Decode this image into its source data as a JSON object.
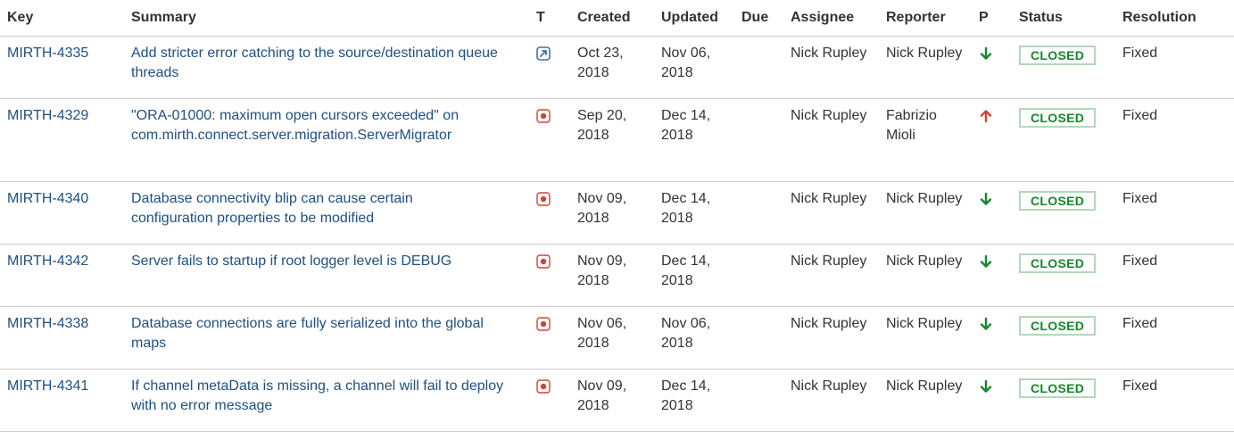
{
  "columns": {
    "key": "Key",
    "summary": "Summary",
    "type": "T",
    "created": "Created",
    "updated": "Updated",
    "due": "Due",
    "assignee": "Assignee",
    "reporter": "Reporter",
    "priority": "P",
    "status": "Status",
    "resolution": "Resolution"
  },
  "colors": {
    "link": "#205081",
    "status_closed_text": "#14892c",
    "status_closed_border": "#b2d8b9",
    "priority_low": "#14892c",
    "priority_high": "#d04437",
    "bug_icon": "#d04437",
    "improvement_icon": "#3b73af"
  },
  "issues": [
    {
      "key": "MIRTH-4335",
      "summary": "Add stricter error catching to the source/destination queue threads",
      "type_icon": "improvement-icon",
      "created": "Oct 23, 2018",
      "updated": "Nov 06, 2018",
      "due": "",
      "assignee": "Nick Rupley",
      "reporter": "Nick Rupley",
      "priority_icon": "arrow-down-icon",
      "status": "CLOSED",
      "resolution": "Fixed"
    },
    {
      "key": "MIRTH-4329",
      "summary": "\"ORA-01000: maximum open cursors exceeded\" on com.mirth.connect.server.migration.ServerMigrator",
      "type_icon": "bug-icon",
      "created": "Sep 20, 2018",
      "updated": "Dec 14, 2018",
      "due": "",
      "assignee": "Nick Rupley",
      "reporter": "Fabrizio Mioli",
      "priority_icon": "arrow-up-icon",
      "status": "CLOSED",
      "resolution": "Fixed"
    },
    {
      "key": "MIRTH-4340",
      "summary": "Database connectivity blip can cause certain configuration properties to be modified",
      "type_icon": "bug-icon",
      "created": "Nov 09, 2018",
      "updated": "Dec 14, 2018",
      "due": "",
      "assignee": "Nick Rupley",
      "reporter": "Nick Rupley",
      "priority_icon": "arrow-down-icon",
      "status": "CLOSED",
      "resolution": "Fixed"
    },
    {
      "key": "MIRTH-4342",
      "summary": "Server fails to startup if root logger level is DEBUG",
      "type_icon": "bug-icon",
      "created": "Nov 09, 2018",
      "updated": "Dec 14, 2018",
      "due": "",
      "assignee": "Nick Rupley",
      "reporter": "Nick Rupley",
      "priority_icon": "arrow-down-icon",
      "status": "CLOSED",
      "resolution": "Fixed"
    },
    {
      "key": "MIRTH-4338",
      "summary": "Database connections are fully serialized into the global maps",
      "type_icon": "bug-icon",
      "created": "Nov 06, 2018",
      "updated": "Nov 06, 2018",
      "due": "",
      "assignee": "Nick Rupley",
      "reporter": "Nick Rupley",
      "priority_icon": "arrow-down-icon",
      "status": "CLOSED",
      "resolution": "Fixed"
    },
    {
      "key": "MIRTH-4341",
      "summary": "If channel metaData is missing, a channel will fail to deploy with no error message",
      "type_icon": "bug-icon",
      "created": "Nov 09, 2018",
      "updated": "Dec 14, 2018",
      "due": "",
      "assignee": "Nick Rupley",
      "reporter": "Nick Rupley",
      "priority_icon": "arrow-down-icon",
      "status": "CLOSED",
      "resolution": "Fixed"
    }
  ]
}
